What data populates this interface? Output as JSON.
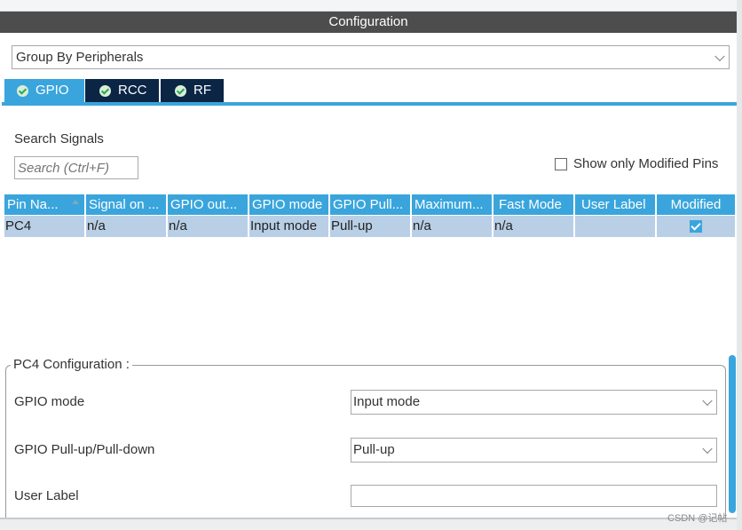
{
  "header": {
    "title": "Configuration"
  },
  "group_by": {
    "value": "Group By Peripherals"
  },
  "tabs": [
    {
      "label": "GPIO",
      "active": true
    },
    {
      "label": "RCC",
      "active": false
    },
    {
      "label": "RF",
      "active": false
    }
  ],
  "search": {
    "label": "Search Signals",
    "placeholder": "Search (Ctrl+F)"
  },
  "show_modified": {
    "label": "Show only Modified Pins",
    "checked": false
  },
  "table": {
    "columns": [
      "Pin Na...",
      "Signal on ...",
      "GPIO out...",
      "GPIO mode",
      "GPIO Pull...",
      "Maximum...",
      "Fast Mode",
      "User Label",
      "Modified"
    ],
    "rows": [
      [
        "PC4",
        "n/a",
        "n/a",
        "Input mode",
        "Pull-up",
        "n/a",
        "n/a",
        "",
        true
      ]
    ]
  },
  "config": {
    "title": "PC4 Configuration :",
    "fields": [
      {
        "label": "GPIO mode",
        "value": "Input mode"
      },
      {
        "label": "GPIO Pull-up/Pull-down",
        "value": "Pull-up"
      },
      {
        "label": "User Label",
        "value": ""
      }
    ]
  },
  "watermark": "CSDN @记帖",
  "colors": {
    "accent": "#3aa5dc",
    "tab_inactive": "#0b2545",
    "header": "#4d4d4d",
    "row": "#b8cfe6"
  }
}
